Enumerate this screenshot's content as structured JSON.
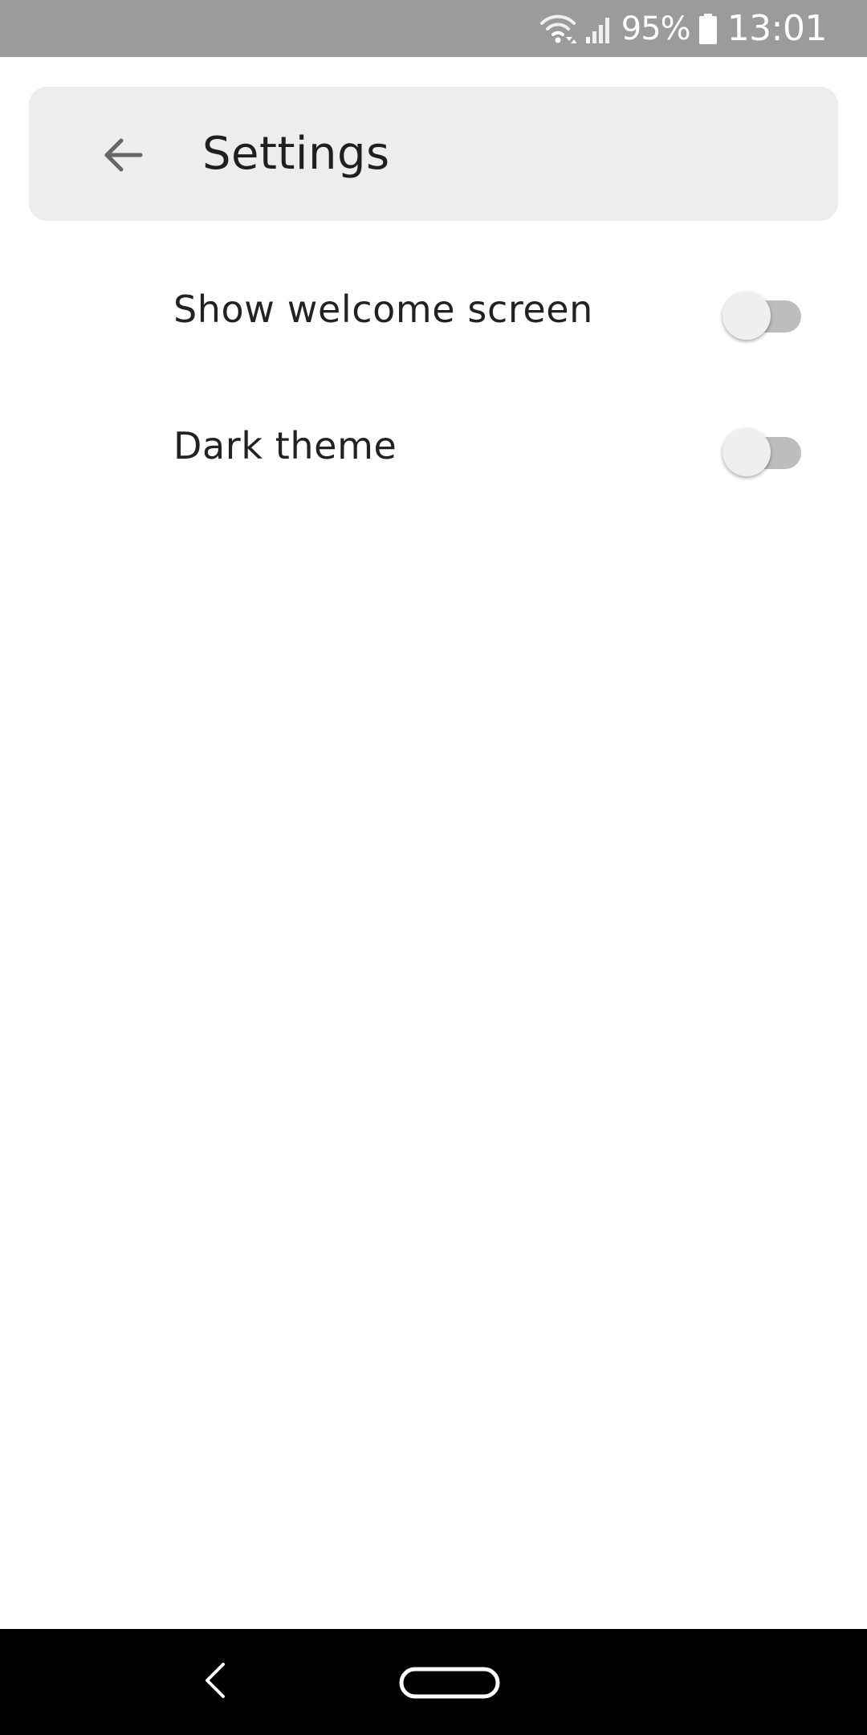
{
  "status_bar": {
    "wifi_icon": "wifi-icon",
    "signal_icon": "signal-icon",
    "battery_percent": "95%",
    "battery_icon": "battery-icon",
    "time": "13:01",
    "background_color": "#9b9b9b"
  },
  "toolbar": {
    "back_icon": "arrow-back-icon",
    "title": "Settings",
    "background_color": "#ededed"
  },
  "settings": {
    "items": [
      {
        "label": "Show welcome screen",
        "enabled": false
      },
      {
        "label": "Dark theme",
        "enabled": false
      }
    ]
  },
  "nav_bar": {
    "back_icon": "nav-back-icon",
    "home_icon": "nav-home-icon",
    "background_color": "#000000"
  }
}
